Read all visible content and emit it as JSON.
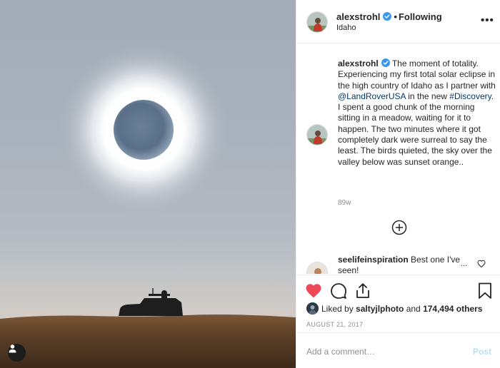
{
  "post": {
    "username": "alexstrohl",
    "follow_label": "Following",
    "location": "Idaho",
    "more_icon_label": "•••",
    "caption_parts": {
      "p1": "The moment of totality. Experiencing my first total solar eclipse in the high country of Idaho as I partner with ",
      "mention": "@LandRoverUSA",
      "p2": " in the new ",
      "hashtag": "#Discovery",
      "p3": ". I spent a good chunk of the morning sitting in a meadow, waiting for it to happen. The two minutes where it got completely dark were surreal to say the least. The birds quieted, the sky over the valley below was sunset orange.."
    },
    "age": "89w",
    "second_comment": {
      "username": "seelifeinspiration",
      "text": "Best one I've seen!",
      "more_label": "..."
    },
    "liked_by_prefix": "Liked by ",
    "liked_by_user": "saltyjlphoto",
    "liked_by_middle": " and ",
    "liked_by_count": "174,494 others",
    "date": "AUGUST 21, 2017",
    "comment_placeholder": "Add a comment…",
    "post_label": "Post"
  },
  "icons": {
    "verified": "verified-badge-icon",
    "like": "heart-icon",
    "comment": "comment-icon",
    "share": "share-icon",
    "save": "bookmark-icon",
    "load_more": "plus-circle-icon",
    "user_tag": "user-icon"
  },
  "colors": {
    "heart_liked": "#ed4956",
    "verified": "#3897f0",
    "link": "#00376b",
    "post_disabled": "#b2dffc"
  }
}
